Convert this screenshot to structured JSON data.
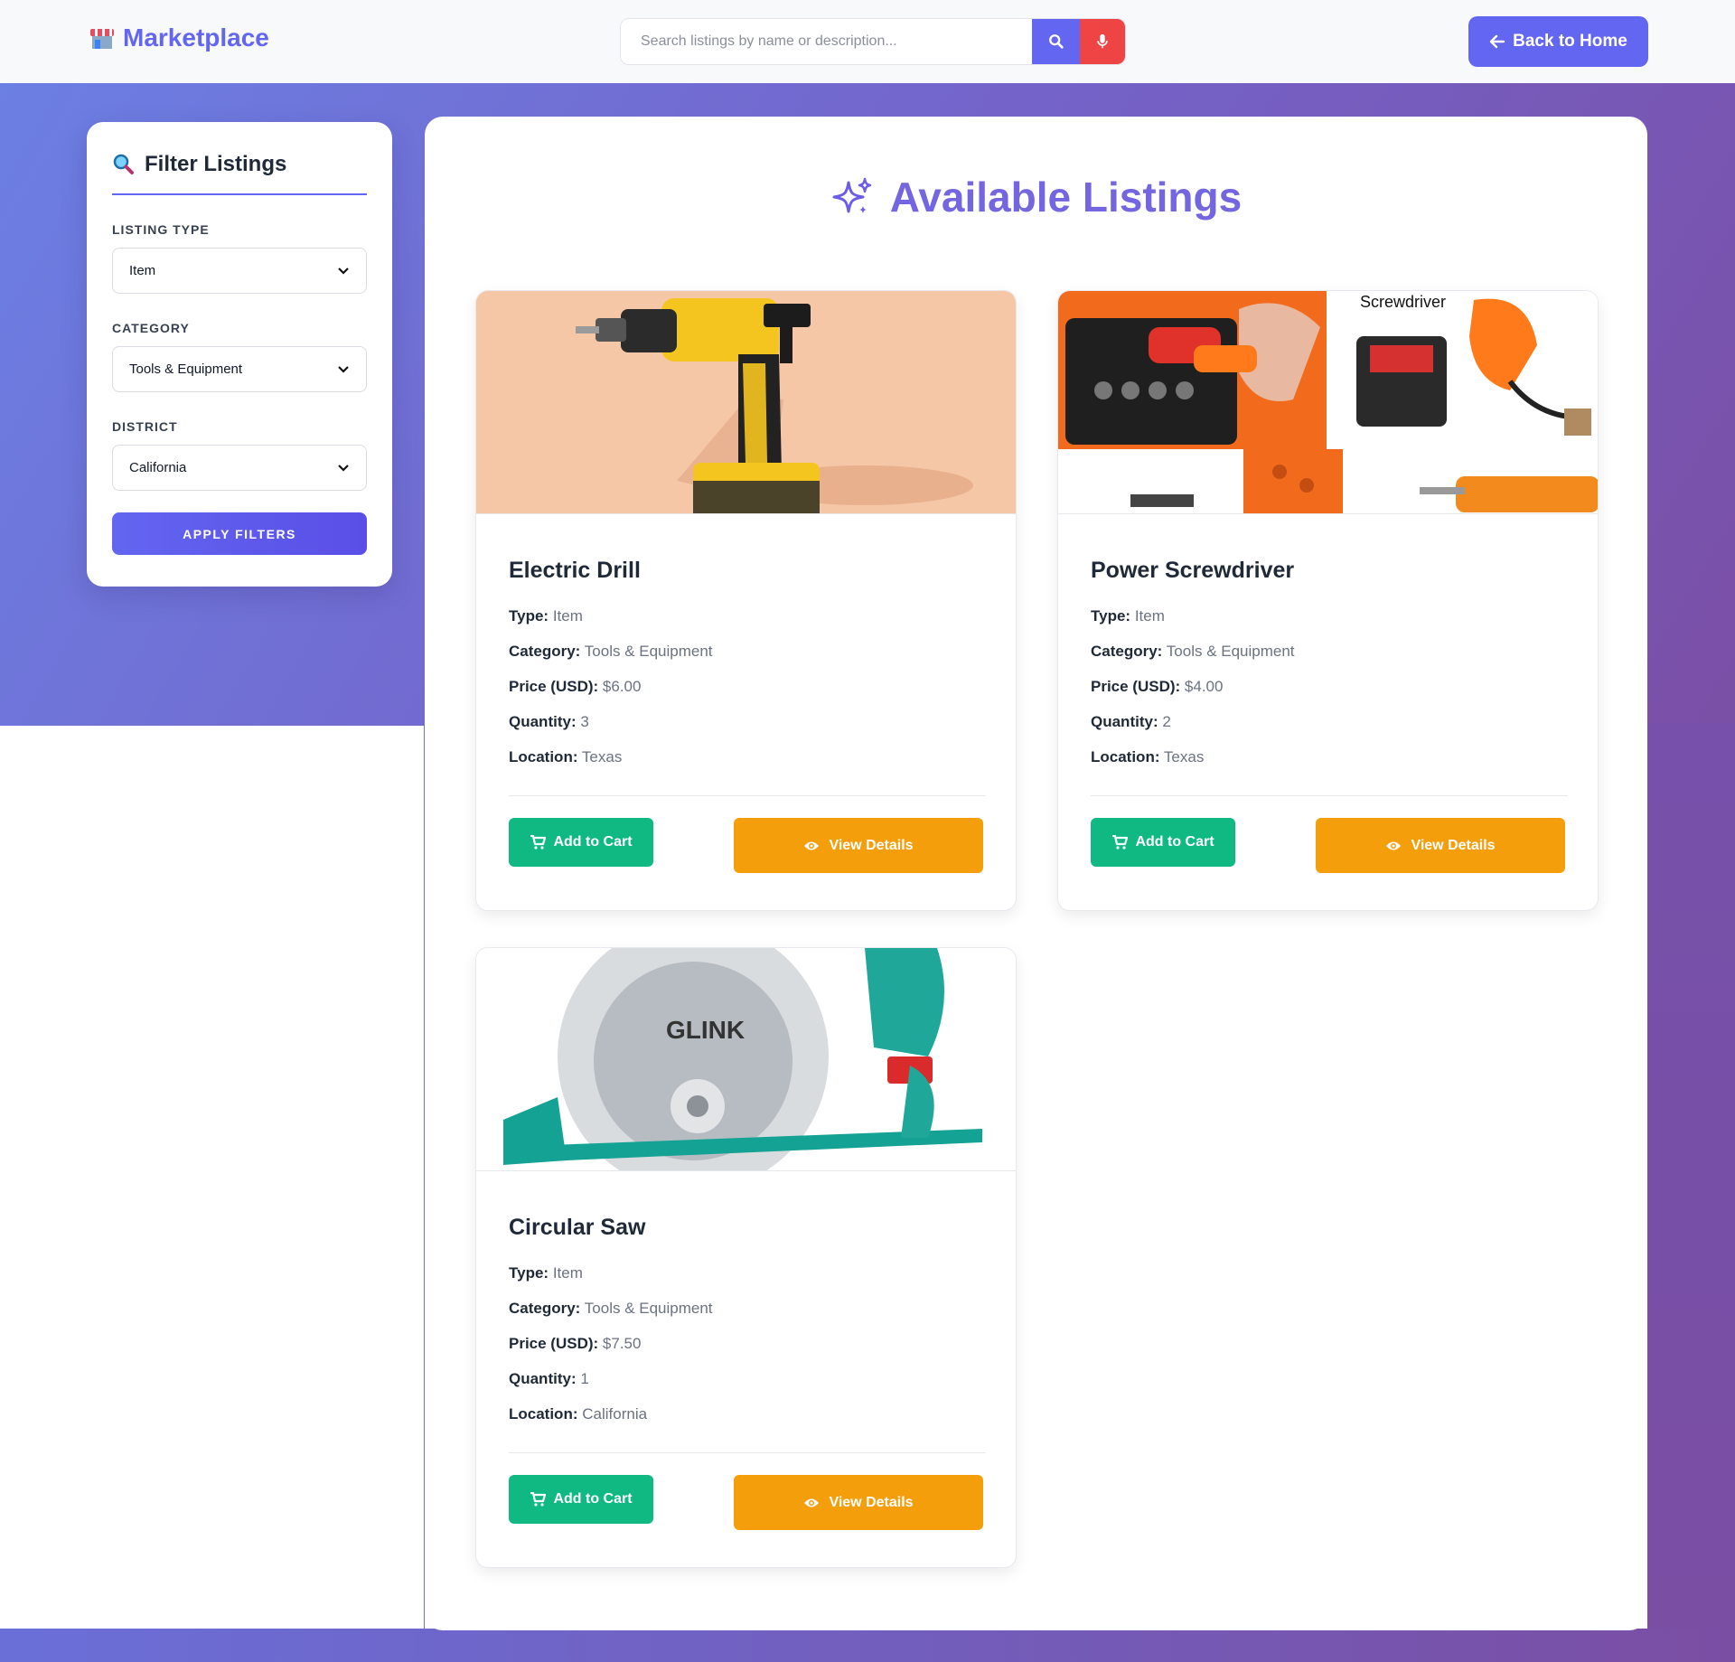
{
  "header": {
    "brand": "Marketplace",
    "search_placeholder": "Search listings by name or description...",
    "back_label": "Back to Home"
  },
  "sidebar": {
    "title": "Filter Listings",
    "filters": [
      {
        "label": "LISTING TYPE",
        "value": "Item"
      },
      {
        "label": "CATEGORY",
        "value": "Tools & Equipment"
      },
      {
        "label": "DISTRICT",
        "value": "California"
      }
    ],
    "apply_label": "APPLY FILTERS"
  },
  "main": {
    "title": "Available Listings",
    "field_labels": {
      "type": "Type:",
      "category": "Category:",
      "price": "Price (USD):",
      "quantity": "Quantity:",
      "location": "Location:"
    },
    "add_to_cart_label": "Add to Cart",
    "view_details_label": "View Details",
    "listings": [
      {
        "name": "Electric Drill",
        "type": "Item",
        "category": "Tools & Equipment",
        "price": "$6.00",
        "quantity": "3",
        "location": "Texas"
      },
      {
        "name": "Power Screwdriver",
        "type": "Item",
        "category": "Tools & Equipment",
        "price": "$4.00",
        "quantity": "2",
        "location": "Texas",
        "image_text": "Screwdriver"
      },
      {
        "name": "Circular Saw",
        "type": "Item",
        "category": "Tools & Equipment",
        "price": "$7.50",
        "quantity": "1",
        "location": "California",
        "image_text": "GLINK"
      }
    ]
  },
  "colors": {
    "accent": "#6366f1",
    "cart": "#10b981",
    "view": "#f59e0b",
    "mic": "#ef4444"
  }
}
